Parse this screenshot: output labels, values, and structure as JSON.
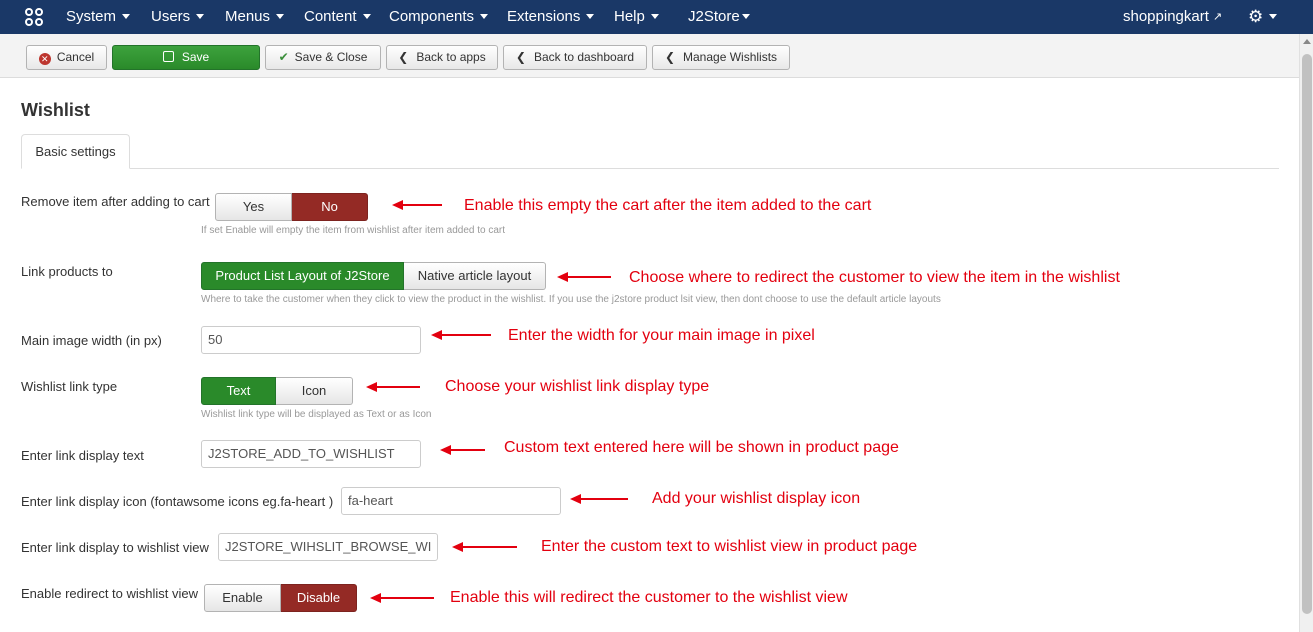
{
  "navbar": {
    "menus": [
      "System",
      "Users",
      "Menus",
      "Content",
      "Components",
      "Extensions",
      "Help"
    ],
    "j2store": "J2Store",
    "site_link": "shoppingkart",
    "settings_icon": "gear-icon"
  },
  "toolbar": {
    "cancel": "Cancel",
    "save": "Save",
    "save_close": "Save & Close",
    "back_apps": "Back to apps",
    "back_dashboard": "Back to dashboard",
    "manage_wishlists": "Manage Wishlists"
  },
  "page": {
    "title": "Wishlist",
    "tab": "Basic settings"
  },
  "fields": {
    "remove_item": {
      "label": "Remove item after adding to cart",
      "options": [
        "Yes",
        "No"
      ],
      "selected": "No",
      "help": "If set Enable will empty the item from wishlist after item added to cart"
    },
    "link_products": {
      "label": "Link products to",
      "options": [
        "Product List Layout of J2Store",
        "Native article layout"
      ],
      "selected": "Product List Layout of J2Store",
      "help": "Where to take the customer when they click to view the product in the wishlist. If you use the j2store product lsit view, then dont choose to use the default article layouts"
    },
    "main_image_width": {
      "label": "Main image width (in px)",
      "value": "50"
    },
    "link_type": {
      "label": "Wishlist link type",
      "options": [
        "Text",
        "Icon"
      ],
      "selected": "Text",
      "help": "Wishlist link type will be displayed as Text or as Icon"
    },
    "link_text": {
      "label": "Enter link display text",
      "value": "J2STORE_ADD_TO_WISHLIST"
    },
    "link_icon": {
      "label": "Enter link display icon (fontawsome icons eg.fa-heart )",
      "value": "fa-heart"
    },
    "link_view": {
      "label": "Enter link display to wishlist view",
      "value": "J2STORE_WIHSLIT_BROWSE_WI"
    },
    "redirect": {
      "label": "Enable redirect to wishlist view",
      "options": [
        "Enable",
        "Disable"
      ],
      "selected": "Disable"
    }
  },
  "annotations": [
    "Enable this empty the cart after the item added to the cart",
    "Choose where to redirect the customer to view the item in the wishlist",
    "Enter the width for your main image in pixel",
    "Choose your wishlist link display type",
    "Custom text entered here will be shown in product page",
    "Add your wishlist display icon",
    "Enter the custom text to wishlist view in product page",
    "Enable this will redirect the customer to the wishlist view"
  ],
  "colors": {
    "navbar": "#1a3867",
    "save_green": "#2a8a2a",
    "active_red": "#942a25",
    "annotation_red": "#e3000f"
  }
}
